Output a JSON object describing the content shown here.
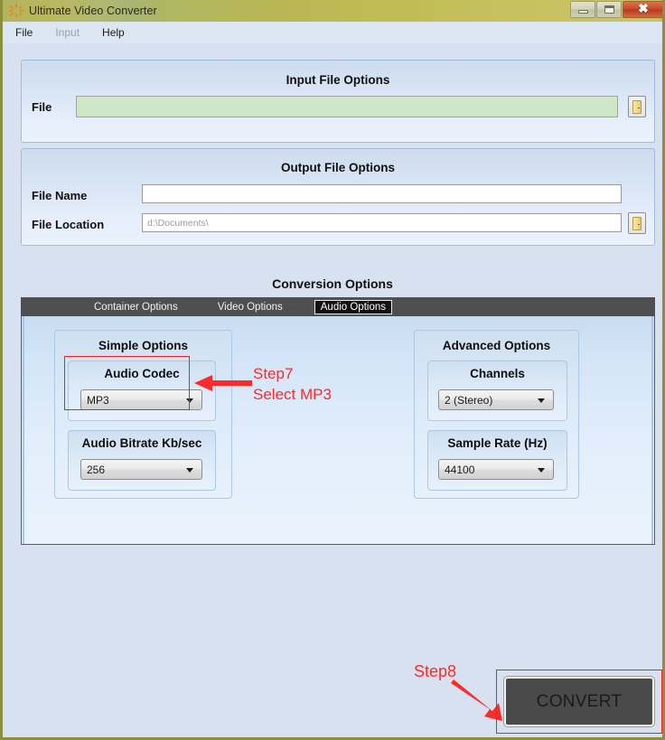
{
  "window": {
    "title": "Ultimate Video Converter",
    "icon": "app-spinner-icon",
    "minimize_label": "",
    "maximize_label": "",
    "close_label": "✖"
  },
  "menubar": {
    "items": [
      {
        "label": "File",
        "disabled": false
      },
      {
        "label": "Input",
        "disabled": true
      },
      {
        "label": "Help",
        "disabled": false
      }
    ]
  },
  "input_group": {
    "title": "Input File Options",
    "file_label": "File",
    "file_value": "",
    "file_placeholder": "",
    "browse_icon": "folder-icon"
  },
  "output_group": {
    "title": "Output File Options",
    "filename_label": "File Name",
    "filename_value": "",
    "filename_placeholder": "",
    "filelocation_label": "File Location",
    "filelocation_value": "",
    "filelocation_placeholder": "d:\\Documents\\",
    "browse_icon": "folder-icon"
  },
  "conversion": {
    "title": "Conversion Options",
    "tabs": [
      {
        "label": "Container Options",
        "active": false
      },
      {
        "label": "Video Options",
        "active": false
      },
      {
        "label": "Audio Options",
        "active": true
      }
    ]
  },
  "simple_options": {
    "title": "Simple Options",
    "audio_codec": {
      "title": "Audio Codec",
      "value": "MP3"
    },
    "audio_bitrate": {
      "title": "Audio Bitrate Kb/sec",
      "value": "256"
    }
  },
  "advanced_options": {
    "title": "Advanced Options",
    "channels": {
      "title": "Channels",
      "value": "2 (Stereo)"
    },
    "sample_rate": {
      "title": "Sample Rate (Hz)",
      "value": "44100"
    }
  },
  "annotations": {
    "step7": "Step7\nSelect MP3",
    "step8": "Step8",
    "color": "#fa2b2b"
  },
  "convert_button": {
    "label": "CONVERT"
  },
  "colors": {
    "titlebar_olive": "#bdbb54",
    "window_bg": "#d7e1ef",
    "panel_blue": "#dce9f9",
    "input_green": "#cde7c7",
    "tabbar_dark": "#4f4f4f",
    "convert_dark": "#4a4a4a",
    "annotation_red": "#fa2b2b"
  }
}
